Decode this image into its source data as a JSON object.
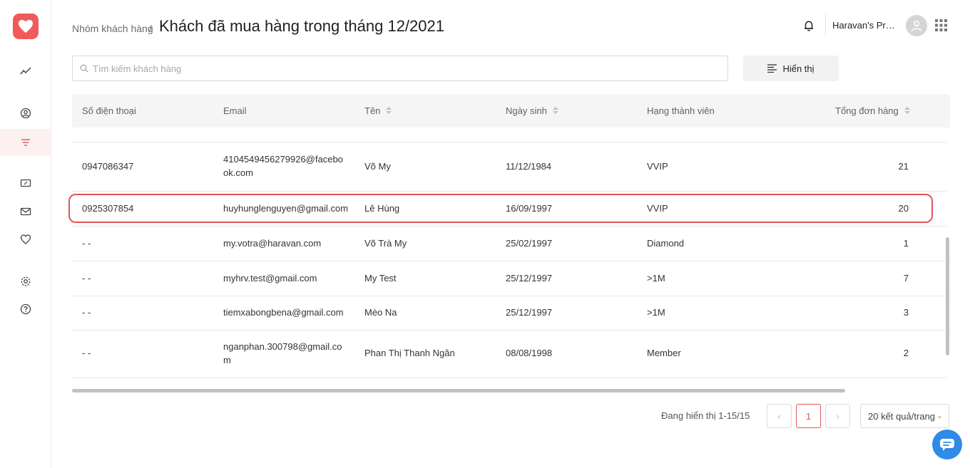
{
  "header": {
    "breadcrumb_parent": "Nhóm khách hàng",
    "breadcrumb_sep": "/",
    "title": "Khách đã mua hàng trong tháng 12/2021",
    "store_name": "Haravan's Pro..."
  },
  "sidebar": {
    "items": [
      {
        "icon": "analytics-icon"
      },
      {
        "icon": "customer-icon"
      },
      {
        "icon": "filter-icon",
        "active": true
      },
      {
        "icon": "voucher-icon"
      },
      {
        "icon": "mail-icon"
      },
      {
        "icon": "heart-icon"
      },
      {
        "icon": "settings-icon"
      },
      {
        "icon": "help-icon"
      }
    ]
  },
  "search": {
    "placeholder": "Tìm kiếm khách hàng"
  },
  "toolbar": {
    "display_label": "Hiển thị"
  },
  "table": {
    "columns": [
      "Số điện thoại",
      "Email",
      "Tên",
      "Ngày sinh",
      "Hạng thành viên",
      "Tổng đơn hàng"
    ],
    "rows": [
      {
        "phone": "0947086347",
        "email": "4104549456279926@facebo ok.com",
        "email_l1": "4104549456279926@facebo",
        "email_l2": "ok.com",
        "name": "Võ My",
        "dob": "11/12/1984",
        "tier": "VVIP",
        "orders": "21"
      },
      {
        "phone": "0925307854",
        "email": "huyhunglenguyen@gmail.com",
        "name": "Lê Hùng",
        "dob": "16/09/1997",
        "tier": "VVIP",
        "orders": "20"
      },
      {
        "phone": "- -",
        "email": "my.votra@haravan.com",
        "name": "Võ Trà My",
        "dob": "25/02/1997",
        "tier": "Diamond",
        "orders": "1"
      },
      {
        "phone": "- -",
        "email": "myhrv.test@gmail.com",
        "name": "My Test",
        "dob": "25/12/1997",
        "tier": ">1M",
        "orders": "7"
      },
      {
        "phone": "- -",
        "email": "tiemxabongbena@gmail.com",
        "name": "Mèo Na",
        "dob": "25/12/1997",
        "tier": ">1M",
        "orders": "3"
      },
      {
        "phone": "- -",
        "email": "nganphan.300798@gmail.co m",
        "email_l1": "nganphan.300798@gmail.co",
        "email_l2": "m",
        "name": "Phan Thị Thanh Ngân",
        "dob": "08/08/1998",
        "tier": "Member",
        "orders": "2"
      }
    ]
  },
  "pagination": {
    "summary": "Đang hiển thị 1-15/15",
    "prev": "‹",
    "current_page": "1",
    "next": "›",
    "per_page": "20 kết quả/trang"
  },
  "colors": {
    "brand": "#f05a5a",
    "highlight": "#e05555",
    "chat": "#2e8be6"
  }
}
